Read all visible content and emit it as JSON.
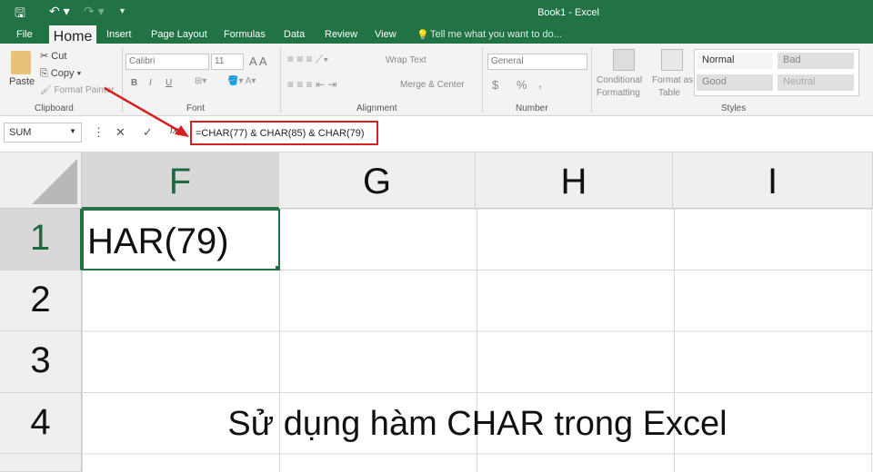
{
  "app": {
    "title": "Book1 - Excel",
    "accent": "#217346"
  },
  "quick_access": {
    "save": "save-icon",
    "undo": "undo-icon",
    "redo": "redo-icon",
    "customize": "▾"
  },
  "tabs": [
    "File",
    "Home",
    "Insert",
    "Page Layout",
    "Formulas",
    "Data",
    "Review",
    "View"
  ],
  "tell_me": "Tell me what you want to do...",
  "ribbon": {
    "clipboard": {
      "paste": "Paste",
      "cut": "Cut",
      "copy": "Copy",
      "format_painter": "Format Painter",
      "label": "Clipboard"
    },
    "font": {
      "name": "Calibri",
      "size": "11",
      "bold": "B",
      "italic": "I",
      "underline": "U",
      "label": "Font"
    },
    "alignment": {
      "wrap": "Wrap Text",
      "merge": "Merge & Center",
      "label": "Alignment"
    },
    "number": {
      "format": "General",
      "currency": "$",
      "percent": "%",
      "comma": ",",
      "label": "Number"
    },
    "styles": {
      "conditional": "Conditional",
      "conditional2": "Formatting",
      "format_table": "Format as",
      "format_table2": "Table",
      "normal": "Normal",
      "bad": "Bad",
      "good": "Good",
      "neutral": "Neutral",
      "label": "Styles"
    }
  },
  "formula_bar": {
    "name_box": "SUM",
    "formula": "=CHAR(77) & CHAR(85) & CHAR(79)",
    "fx": "fx"
  },
  "columns": [
    "F",
    "G",
    "H",
    "I"
  ],
  "rows": [
    "1",
    "2",
    "3",
    "4"
  ],
  "cells": {
    "F1": "HAR(79)"
  },
  "caption": "Sử dụng hàm CHAR trong Excel"
}
